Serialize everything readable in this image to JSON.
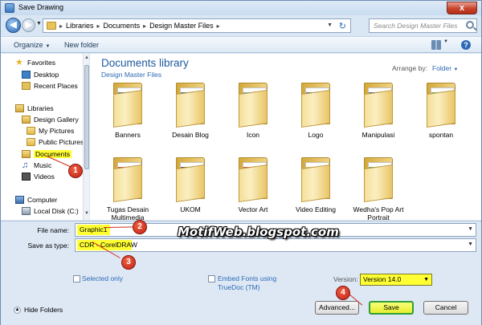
{
  "window": {
    "title": "Save Drawing",
    "close_glyph": "x"
  },
  "address_bar": {
    "crumbs": [
      "Libraries",
      "Documents",
      "Design Master Files"
    ],
    "search_placeholder": "Search Design Master Files"
  },
  "toolbar": {
    "organize_label": "Organize",
    "new_folder_label": "New folder",
    "help_glyph": "?"
  },
  "nav_pane": {
    "favorites_label": "Favorites",
    "desktop_label": "Desktop",
    "recent_label": "Recent Places",
    "libraries_label": "Libraries",
    "design_gallery_label": "Design Gallery",
    "my_pictures_label": "My Pictures",
    "public_pictures_label": "Public Pictures",
    "documents_label": "Documents",
    "music_label": "Music",
    "videos_label": "Videos",
    "computer_label": "Computer",
    "local_disk_label": "Local Disk (C:)"
  },
  "library": {
    "title": "Documents library",
    "subtitle": "Design Master Files",
    "arrange_label": "Arrange by:",
    "arrange_value": "Folder"
  },
  "folders": [
    {
      "label": "Banners",
      "icon": "photoshop-folder-icon",
      "art_color": "#1f4e8c"
    },
    {
      "label": "Desain Blog",
      "icon": "photoshop-folder-icon",
      "art_color": "#1f4e8c"
    },
    {
      "label": "Icon",
      "icon": "folder-icon",
      "art_color": "#3b8fd6"
    },
    {
      "label": "Logo",
      "icon": "photoshop-folder-icon",
      "art_color": "#1f4e8c"
    },
    {
      "label": "Manipulasi",
      "icon": "photoshop-folder-icon",
      "art_color": "#0f3c6e"
    },
    {
      "label": "spontan",
      "icon": "image-folder-icon",
      "art_color": "#5aa052"
    },
    {
      "label": "Tugas Desain Multimedia",
      "icon": "flash-folder-icon",
      "art_color": "#c42a1c"
    },
    {
      "label": "UKOM",
      "icon": "sketch-folder-icon",
      "art_color": "#333333"
    },
    {
      "label": "Vector Art",
      "icon": "folder-icon",
      "art_color": "#c42a1c"
    },
    {
      "label": "Video Editing",
      "icon": "stacked-folder-icon",
      "art_color": "#e2b848"
    },
    {
      "label": "Wedha's Pop Art Portrait",
      "icon": "image-folder-icon",
      "art_color": "#5aa052"
    }
  ],
  "form": {
    "file_name_label": "File name:",
    "file_name_value": "Graphic1",
    "save_type_label": "Save as type:",
    "save_type_value": "CDR - CorelDRAW",
    "selected_only_label": "Selected only",
    "embed_fonts_label_1": "Embed Fonts using",
    "embed_fonts_label_2": "TrueDoc (TM)",
    "version_label": "Version:",
    "version_value": "Version 14.0"
  },
  "footer": {
    "hide_folders_label": "Hide Folders",
    "advanced_label": "Advanced...",
    "save_label": "Save",
    "cancel_label": "Cancel"
  },
  "annotations": {
    "marker_1": "1",
    "marker_2": "2",
    "marker_3": "3",
    "marker_4": "4",
    "watermark": "MotifWeb.blogspot.com"
  },
  "colors": {
    "highlight": "#ffff33",
    "marker": "#d42a1c",
    "link": "#2e6ab5",
    "save_border": "#2e9e3a"
  }
}
